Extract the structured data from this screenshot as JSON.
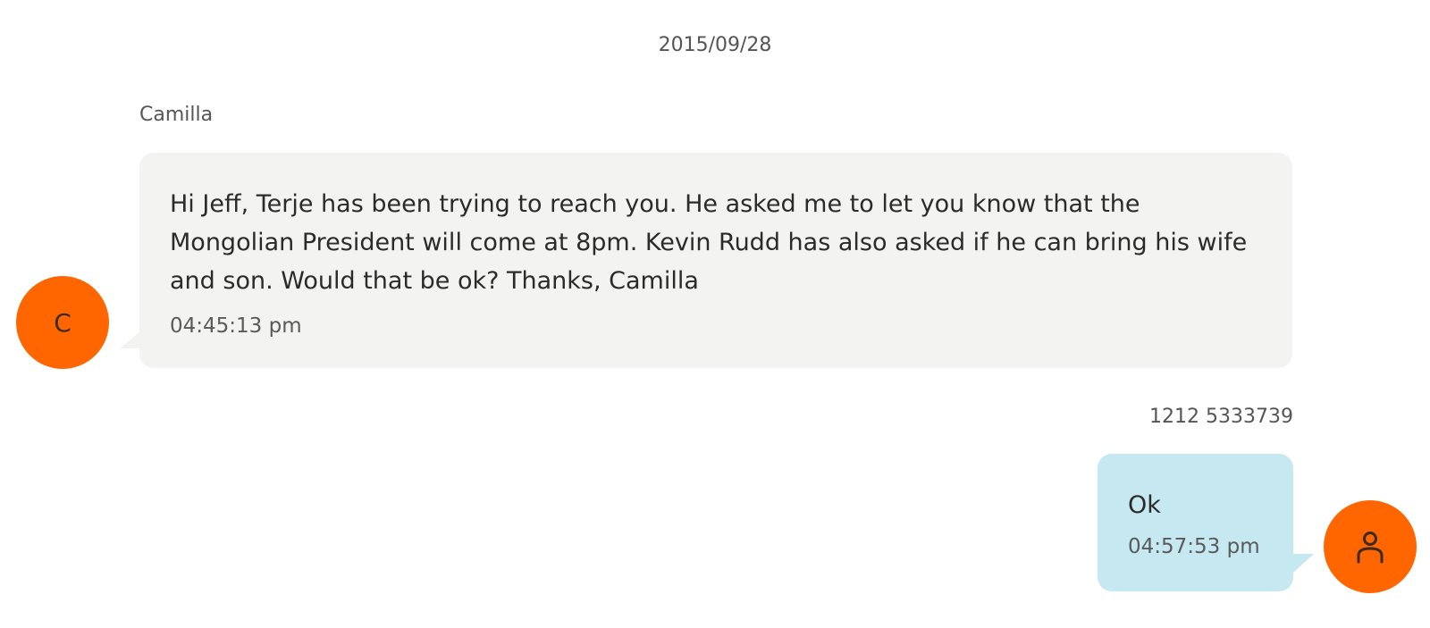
{
  "conversation": {
    "date": "2015/09/28",
    "messages": [
      {
        "direction": "incoming",
        "sender": "Camilla",
        "avatar_initial": "C",
        "text": "Hi Jeff, Terje has been trying to reach you. He asked me to let you know that the Mongolian President will come at 8pm. Kevin Rudd has also asked if he can bring his wife and son. Would that be ok? Thanks, Camilla",
        "time": "04:45:13 pm"
      },
      {
        "direction": "outgoing",
        "sender": "1212 5333739",
        "avatar_icon": "user-icon",
        "text": "Ok",
        "time": "04:57:53 pm"
      }
    ]
  },
  "colors": {
    "avatar": "#ff6600",
    "incoming_bubble": "#f3f3f1",
    "outgoing_bubble": "#c6e8f1"
  }
}
